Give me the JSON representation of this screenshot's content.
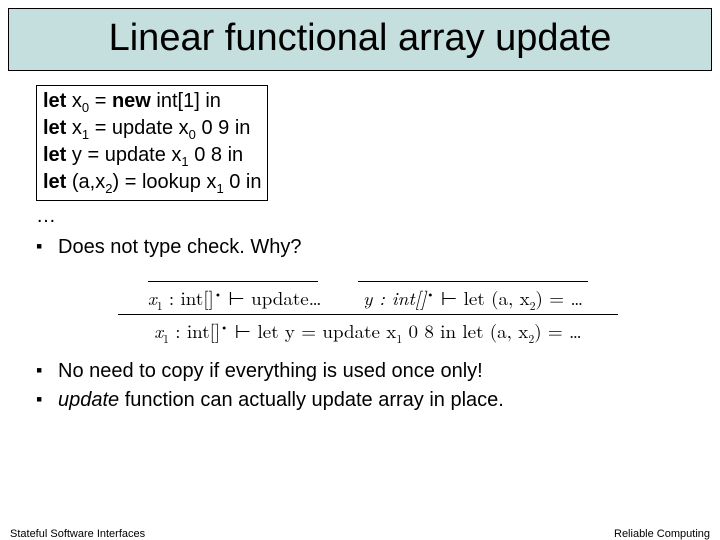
{
  "title": "Linear functional array update",
  "code": {
    "l1_pre": "let",
    "l1_var": " x",
    "l1_sub": "0",
    "l1_mid": " = ",
    "l1_kw2": "new",
    "l1_post": " int[1] in",
    "l2_pre": "let",
    "l2_var": " x",
    "l2_sub": "1",
    "l2_mid": " = update x",
    "l2_sub2": "0",
    "l2_post": " 0 9 in",
    "l3_pre": "let",
    "l3_mid": " y = update x",
    "l3_sub": "1",
    "l3_post": " 0 8 in",
    "l4_pre": "let",
    "l4_mid": " (a,x",
    "l4_sub": "2",
    "l4_mid2": ") = lookup x",
    "l4_sub2": "1",
    "l4_post": " 0 in"
  },
  "ellipsis": "…",
  "bullets1": {
    "b1": "Does not type check. Why?"
  },
  "math": {
    "top1_a": "x",
    "top1_sub": "1",
    "top1_b": " : int[]",
    "top1_c": " ⊢ update…",
    "top2_a": "y : int[]",
    "top2_b": " ⊢ let (a, x",
    "top2_sub": "2",
    "top2_c": ") = …",
    "bot_a": "x",
    "bot_sub": "1",
    "bot_b": " : int[]",
    "bot_c": " ⊢ let y = update x",
    "bot_sub2": "1",
    "bot_d": " 0 8 in let (a, x",
    "bot_sub3": "2",
    "bot_e": ") = …"
  },
  "bullets2": {
    "b2": "No need to copy if everything is used once only!",
    "b3_pre": "update",
    "b3_post": " function can actually update array in place."
  },
  "footer": {
    "left": "Stateful Software Interfaces",
    "right": "Reliable Computing"
  }
}
